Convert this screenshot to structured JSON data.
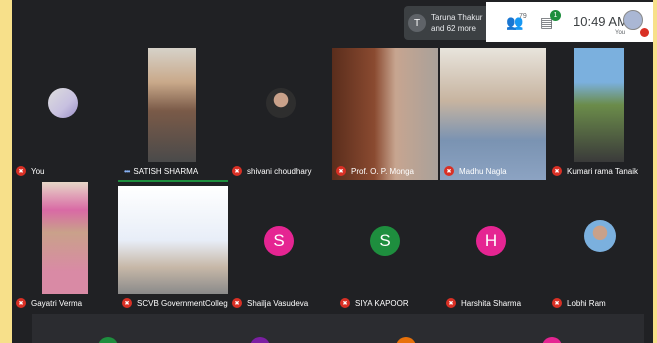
{
  "header": {
    "participants_avatar_initial": "T",
    "participants_summary_line1": "Taruna Thakur",
    "participants_summary_line2": "and 62 more",
    "people_count": "79",
    "chat_badge": "1",
    "clock": "10:49 AM",
    "self_label": "You"
  },
  "tiles": [
    {
      "name": "You",
      "muted": true,
      "kind": "avatar-photo"
    },
    {
      "name": "SATISH SHARMA",
      "muted": false,
      "kind": "video"
    },
    {
      "name": "shivani choudhary",
      "muted": true,
      "kind": "avatar-photo"
    },
    {
      "name": "Prof. O. P. Monga",
      "muted": true,
      "kind": "video"
    },
    {
      "name": "Madhu Nagla",
      "muted": true,
      "kind": "video"
    },
    {
      "name": "Kumari rama Tanaik",
      "muted": true,
      "kind": "video"
    },
    {
      "name": "Gayatri Verma",
      "muted": true,
      "kind": "video"
    },
    {
      "name": "SCVB GovernmentCollege",
      "muted": true,
      "kind": "video"
    },
    {
      "name": "Shailja Vasudeva",
      "muted": true,
      "kind": "letter",
      "initial": "S",
      "color": "#e52592"
    },
    {
      "name": "SIYA KAPOOR",
      "muted": true,
      "kind": "letter",
      "initial": "S",
      "color": "#1e8e3e"
    },
    {
      "name": "Harshita Sharma",
      "muted": true,
      "kind": "letter",
      "initial": "H",
      "color": "#e52592"
    },
    {
      "name": "Lobhi Ram",
      "muted": true,
      "kind": "avatar-photo"
    }
  ],
  "colors": {
    "background_frame": "#f7e08a",
    "stage": "#202124",
    "tile": "#3c4043",
    "muted_red": "#d93025"
  }
}
